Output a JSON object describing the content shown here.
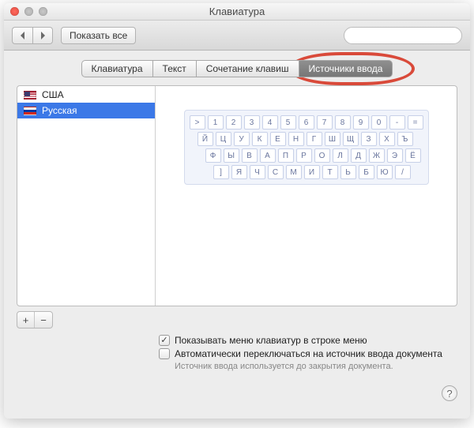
{
  "window": {
    "title": "Клавиатура"
  },
  "toolbar": {
    "show_all": "Показать все"
  },
  "tabs": [
    {
      "label": "Клавиатура"
    },
    {
      "label": "Текст"
    },
    {
      "label": "Сочетание клавиш"
    },
    {
      "label": "Источники ввода"
    }
  ],
  "active_tab_index": 3,
  "sources": [
    {
      "label": "США",
      "flag": "us"
    },
    {
      "label": "Русская",
      "flag": "ru"
    }
  ],
  "selected_source_index": 1,
  "keyboard_rows": [
    [
      ">",
      "1",
      "2",
      "3",
      "4",
      "5",
      "6",
      "7",
      "8",
      "9",
      "0",
      "-",
      "="
    ],
    [
      "Й",
      "Ц",
      "У",
      "К",
      "Е",
      "Н",
      "Г",
      "Ш",
      "Щ",
      "З",
      "Х",
      "Ъ"
    ],
    [
      "Ф",
      "Ы",
      "В",
      "А",
      "П",
      "Р",
      "О",
      "Л",
      "Д",
      "Ж",
      "Э",
      "Ё"
    ],
    [
      "]",
      "Я",
      "Ч",
      "С",
      "М",
      "И",
      "Т",
      "Ь",
      "Б",
      "Ю",
      "/"
    ]
  ],
  "add_label": "+",
  "remove_label": "−",
  "checkboxes": {
    "show_menu": {
      "checked": true,
      "label": "Показывать меню клавиатур в строке меню"
    },
    "auto_switch": {
      "checked": false,
      "label": "Автоматически переключаться на источник ввода документа"
    }
  },
  "hint": "Источник ввода используется до закрытия документа.",
  "help_label": "?"
}
